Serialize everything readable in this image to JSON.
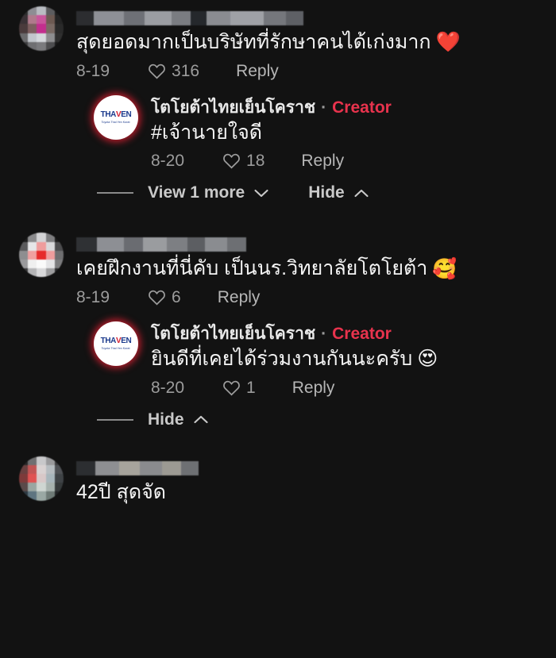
{
  "app": {
    "background_color": "#121212",
    "text_color": "#f4f4f4",
    "meta_color": "#9c9c9c",
    "creator_badge_color": "#e8334d"
  },
  "comments": [
    {
      "id": "comment-1",
      "author_hidden": true,
      "author_name": "",
      "text": "สุดยอดมากเป็นบริษัทที่รักษาคนได้เก่งมาก",
      "emoji": "❤️",
      "date": "8-19",
      "likes": "316",
      "reply_label": "Reply"
    },
    {
      "id": "reply-1",
      "author_name": "โตโยต้าไทยเย็นโคราช",
      "separator": "·",
      "badge": "Creator",
      "text": "#เจ้านายใจดี",
      "emoji": "",
      "date": "8-20",
      "likes": "18",
      "reply_label": "Reply"
    },
    {
      "id": "comment-2",
      "author_hidden": true,
      "author_name": "",
      "text": "เคยฝึกงานที่นี่คับ เป็นนร.วิทยาลัยโตโยต้า",
      "emoji": "🥰",
      "date": "8-19",
      "likes": "6",
      "reply_label": "Reply"
    },
    {
      "id": "reply-2",
      "author_name": "โตโยต้าไทยเย็นโคราช",
      "separator": "·",
      "badge": "Creator",
      "text": "ยินดีที่เคยได้ร่วมงานกันนะครับ",
      "emoji": "😍",
      "date": "8-20",
      "likes": "1",
      "reply_label": "Reply"
    },
    {
      "id": "comment-3",
      "author_hidden": true,
      "author_name": "",
      "text": "42ปี สุดจัด",
      "emoji": "",
      "date": "",
      "likes": "",
      "reply_label": ""
    }
  ],
  "thread_controls": [
    {
      "id": "thread-1",
      "view_more_label": "View 1 more",
      "hide_label": "Hide"
    },
    {
      "id": "thread-2",
      "view_more_label": "",
      "hide_label": "Hide"
    }
  ],
  "creator_logo": {
    "primary_text_a": "THA",
    "primary_text_b": "V",
    "primary_text_c": "EN",
    "sub_text": "Toyota Thai Yen Korat"
  }
}
